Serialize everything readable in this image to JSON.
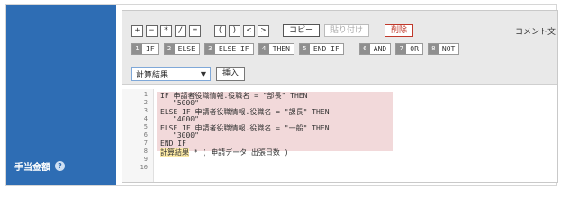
{
  "field": {
    "label": "手当金額",
    "help_icon": "question-circle-icon"
  },
  "toolbar": {
    "operators": [
      "+",
      "−",
      "*",
      "/",
      "="
    ],
    "brackets": [
      "(",
      ")",
      "<",
      ">"
    ],
    "copy_label": "コピー",
    "paste_label": "貼り付け",
    "delete_label": "削除",
    "comment_label": "コメント文",
    "keywords": [
      {
        "num": "1",
        "label": "IF"
      },
      {
        "num": "2",
        "label": "ELSE"
      },
      {
        "num": "3",
        "label": "ELSE IF"
      },
      {
        "num": "4",
        "label": "THEN"
      },
      {
        "num": "5",
        "label": "END IF"
      },
      {
        "num": "6",
        "label": "AND"
      },
      {
        "num": "7",
        "label": "OR"
      },
      {
        "num": "8",
        "label": "NOT"
      }
    ],
    "select_value": "計算結果",
    "insert_label": "挿入"
  },
  "code": {
    "line_numbers": [
      "1",
      "2",
      "3",
      "4",
      "5",
      "6",
      "7",
      "8",
      "9",
      "10"
    ],
    "lines": [
      "IF 申請者役職情報.役職名 = \"部長\" THEN",
      "\"5000\"",
      "ELSE IF 申請者役職情報.役職名 = \"課長\" THEN",
      "\"4000\"",
      "ELSE IF 申請者役職情報.役職名 = \"一般\" THEN",
      "\"3000\"",
      "END IF"
    ],
    "line8_token": "計算結果",
    "line8_rest": " * ( 申請データ.出張日数 )"
  }
}
